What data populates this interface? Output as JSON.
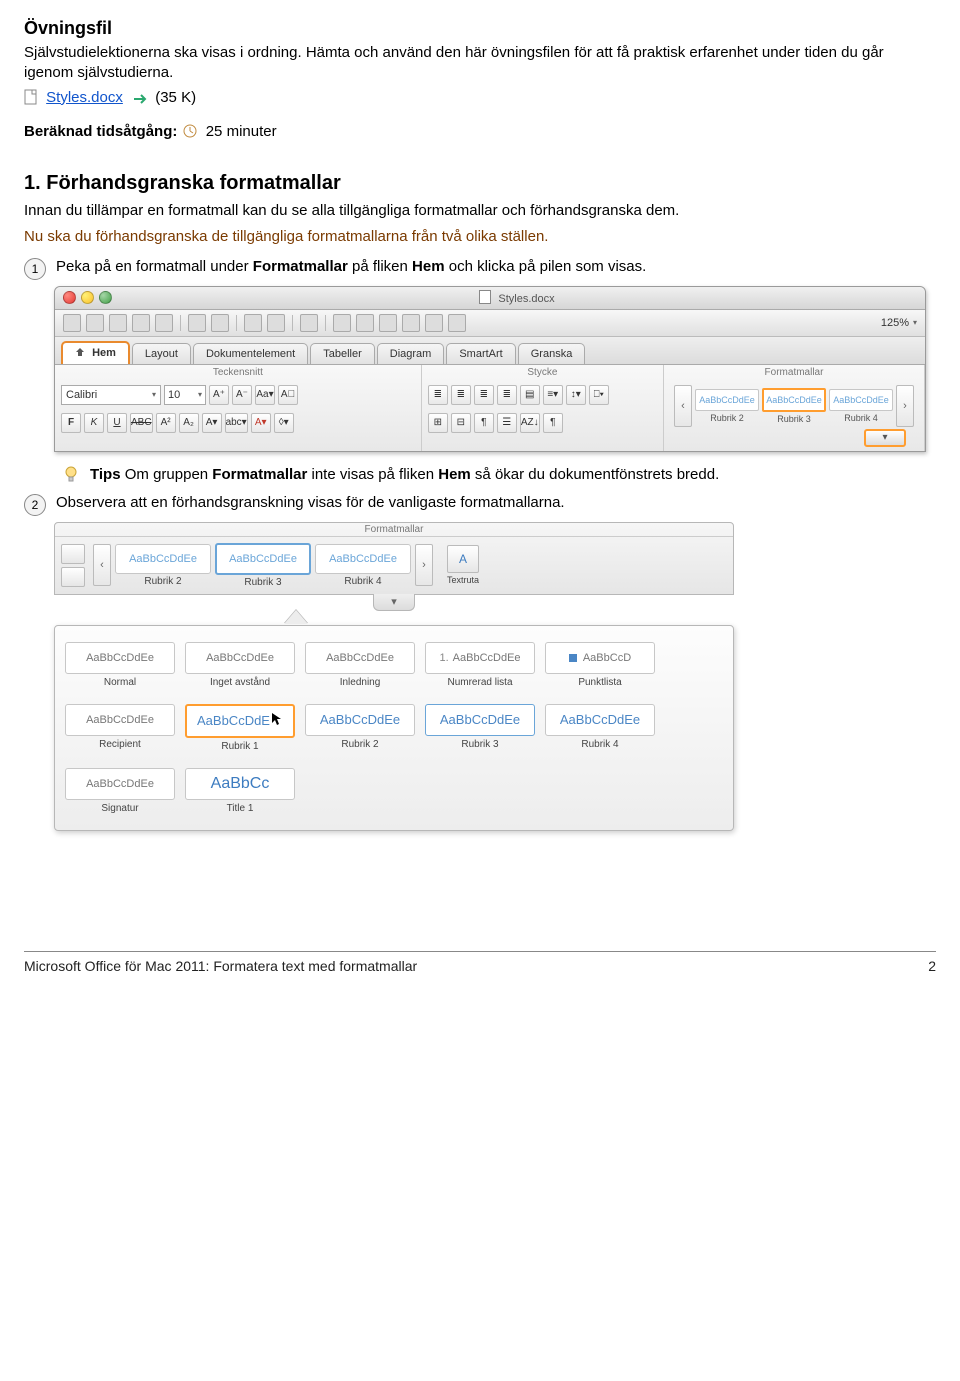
{
  "header": {
    "title": "Övningsfil",
    "intro": "Självstudielektionerna ska visas i ordning. Hämta och använd den här övningsfilen för att få praktisk erfarenhet under tiden du går igenom självstudierna.",
    "filelink": "Styles.docx",
    "filesize": "(35 K)",
    "time_label": "Beräknad tidsåtgång:",
    "time_value": "25 minuter"
  },
  "section1": {
    "heading": "1. Förhandsgranska formatmallar",
    "p1": "Innan du tillämpar en formatmall kan du se alla tillgängliga formatmallar och förhandsgranska dem.",
    "p2": "Nu ska du förhandsgranska de tillgängliga formatmallarna från två olika ställen.",
    "step1_num": "1",
    "step1_pre": "Peka på en formatmall under ",
    "step1_b1": "Formatmallar",
    "step1_mid": " på fliken ",
    "step1_b2": "Hem",
    "step1_post": " och klicka på pilen som visas.",
    "tip_label": "Tips",
    "tip_pre": "  Om gruppen ",
    "tip_b1": "Formatmallar",
    "tip_mid": " inte visas på fliken ",
    "tip_b2": "Hem",
    "tip_post": " så ökar du dokumentfönstrets bredd.",
    "step2_num": "2",
    "step2_text": "Observera att en förhandsgranskning visas för de vanligaste formatmallarna."
  },
  "ribbon1": {
    "docname": "Styles.docx",
    "zoom": "125%",
    "tabs": [
      "Hem",
      "Layout",
      "Dokumentelement",
      "Tabeller",
      "Diagram",
      "SmartArt",
      "Granska"
    ],
    "group_font": "Teckensnitt",
    "group_para": "Stycke",
    "group_styles": "Formatmallar",
    "font_name": "Calibri",
    "font_size": "10",
    "font_btns": [
      "F",
      "K",
      "U",
      "ABC",
      "A²",
      "A₂",
      "A▾",
      "abc▾",
      "A▾",
      "◊▾"
    ],
    "font_btns2": [
      "A⁺",
      "A⁻",
      "Aa▾"
    ],
    "para_btns": [
      "≣",
      "≣",
      "≣",
      "≣",
      "▤",
      "≡▾",
      "↕▾",
      "⎕▾"
    ],
    "para_btns2": [
      "⊞",
      "⊟",
      "¶",
      "☰",
      "AZ↓",
      "¶"
    ],
    "styles": [
      {
        "sample": "AaBbCcDdEe",
        "label": "Rubrik 2",
        "selected": false
      },
      {
        "sample": "AaBbCcDdEe",
        "label": "Rubrik 3",
        "selected": true
      },
      {
        "sample": "AaBbCcDdEe",
        "label": "Rubrik 4",
        "selected": false
      }
    ]
  },
  "gallery": {
    "group_title": "Formatmallar",
    "top_row": [
      {
        "sample": "AaBbCcDdEe",
        "label": "Rubrik 2",
        "selected": false
      },
      {
        "sample": "AaBbCcDdEe",
        "label": "Rubrik 3",
        "selected": true
      },
      {
        "sample": "AaBbCcDdEe",
        "label": "Rubrik 4",
        "selected": false
      }
    ],
    "extra_label": "Textruta",
    "panel": [
      {
        "sample": "AaBbCcDdEe",
        "label": "Normal",
        "type": "plain"
      },
      {
        "sample": "AaBbCcDdEe",
        "label": "Inget avstånd",
        "type": "plain"
      },
      {
        "sample": "AaBbCcDdEe",
        "label": "Inledning",
        "type": "plain"
      },
      {
        "sample": "AaBbCcDdEe",
        "label": "Numrerad lista",
        "type": "numbered"
      },
      {
        "sample": "AaBbCcD",
        "label": "Punktlista",
        "type": "bulleted"
      },
      {
        "sample": "AaBbCcDdEe",
        "label": "Recipient",
        "type": "plain"
      },
      {
        "sample": "AaBbCcDdE",
        "label": "Rubrik 1",
        "type": "blue",
        "selected": true
      },
      {
        "sample": "AaBbCcDdEe",
        "label": "Rubrik 2",
        "type": "blue"
      },
      {
        "sample": "AaBbCcDdEe",
        "label": "Rubrik 3",
        "type": "blue",
        "blueborder": true
      },
      {
        "sample": "AaBbCcDdEe",
        "label": "Rubrik 4",
        "type": "blue"
      },
      {
        "sample": "AaBbCcDdEe",
        "label": "Signatur",
        "type": "plain"
      },
      {
        "sample": "AaBbCc",
        "label": "Title 1",
        "type": "big"
      }
    ]
  },
  "footer": {
    "left": "Microsoft Office för Mac 2011: Formatera text med formatmallar",
    "right": "2"
  },
  "glyphs": {
    "caret_down": "▾",
    "left": "‹",
    "right": "›"
  }
}
